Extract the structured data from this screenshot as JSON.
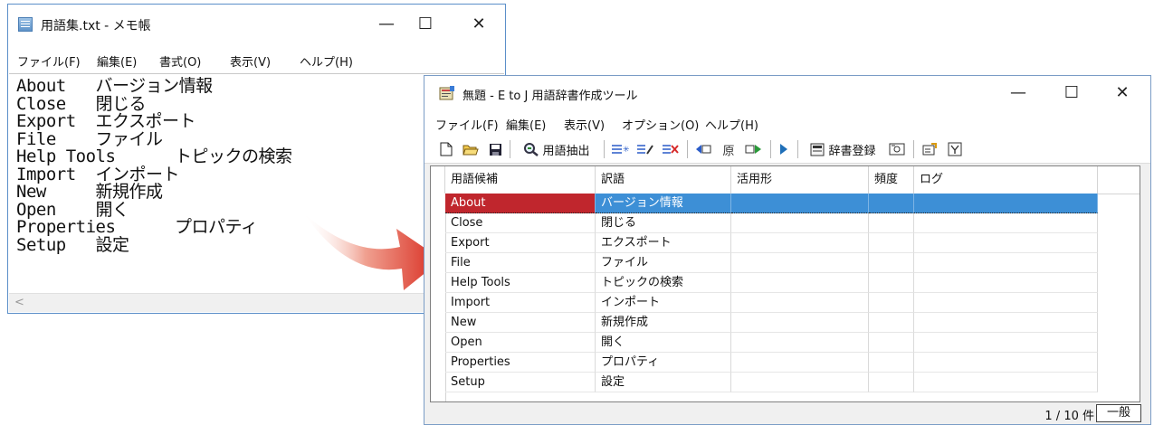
{
  "notepad": {
    "title": "用語集.txt - メモ帳",
    "menu": [
      "ファイル(F)",
      "編集(E)",
      "書式(O)",
      "表示(V)",
      "ヘルプ(H)"
    ],
    "lines": [
      "About   バージョン情報",
      "Close   閉じる",
      "Export  エクスポート",
      "File    ファイル",
      "Help Tools      トピックの検索",
      "Import  インポート",
      "New     新規作成",
      "Open    開く",
      "Properties      プロパティ",
      "Setup   設定"
    ],
    "scroll_left": "<"
  },
  "tool": {
    "title": "無題 - E to J 用語辞書作成ツール",
    "menu": [
      "ファイル(F)",
      "編集(E)",
      "表示(V)",
      "オプション(O)",
      "ヘルプ(H)"
    ],
    "toolbar": {
      "extract_label": "用語抽出",
      "register_label": "辞書登録"
    },
    "columns": [
      "用語候補",
      "訳語",
      "活用形",
      "頻度",
      "ログ"
    ],
    "rows": [
      {
        "term": "About",
        "translation": "バージョン情報"
      },
      {
        "term": "Close",
        "translation": "閉じる"
      },
      {
        "term": "Export",
        "translation": "エクスポート"
      },
      {
        "term": "File",
        "translation": "ファイル"
      },
      {
        "term": "Help Tools",
        "translation": "トピックの検索"
      },
      {
        "term": "Import",
        "translation": "インポート"
      },
      {
        "term": "New",
        "translation": "新規作成"
      },
      {
        "term": "Open",
        "translation": "開く"
      },
      {
        "term": "Properties",
        "translation": "プロパティ"
      },
      {
        "term": "Setup",
        "translation": "設定"
      }
    ],
    "status": {
      "count": "1 / 10 件",
      "mode": "一般"
    }
  },
  "window_controls": {
    "minimize": "—",
    "maximize": "☐",
    "close": "✕"
  },
  "colors": {
    "selected_row": "#3d8fd6",
    "selected_first_cell": "#c0262d",
    "arrow": "#e03a2a"
  }
}
